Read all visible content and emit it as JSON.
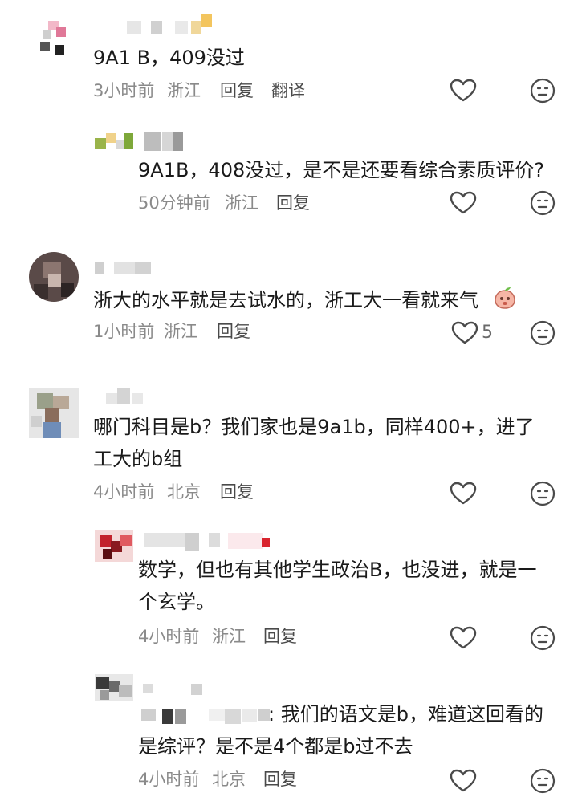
{
  "comments": [
    {
      "text": "9A1 B，409没过",
      "time": "3小时前",
      "location": "浙江",
      "reply_label": "回复",
      "translate_label": "翻译",
      "replies": [
        {
          "text": "9A1B，408没过，是不是还要看综合素质评价?",
          "time": "50分钟前",
          "location": "浙江",
          "reply_label": "回复"
        }
      ]
    },
    {
      "text": "浙大的水平就是去试水的，浙工大一看就来气",
      "time": "1小时前",
      "location": "浙江",
      "reply_label": "回复",
      "like_count": "5",
      "emoji": "peach-emoji"
    },
    {
      "text_line1": "哪门科目是b？我们家也是9a1b，同样400+，进了",
      "text_line2": "工大的b组",
      "time": "4小时前",
      "location": "北京",
      "reply_label": "回复",
      "replies": [
        {
          "text_line1": "数学，但也有其他学生政治B，也没进，就是一",
          "text_line2": "个玄学。",
          "time": "4小时前",
          "location": "浙江",
          "reply_label": "回复"
        },
        {
          "text_line1_suffix": ": 我们的语文是b，难道这回看的",
          "text_line2": "是综评？是不是4个都是b过不去",
          "time": "4小时前",
          "location": "北京",
          "reply_label": "回复"
        }
      ]
    }
  ],
  "colors": {
    "text": "#1a1a1a",
    "meta": "#8a8a8a",
    "icon": "#4a4a4a"
  }
}
